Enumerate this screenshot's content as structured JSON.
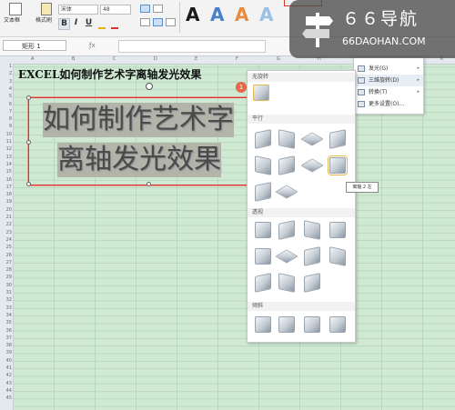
{
  "ribbon": {
    "textbox_label": "文本框",
    "format_painter_label": "格式刷",
    "font_name": "宋体",
    "font_size": "48",
    "bold": "B",
    "italic": "I",
    "underline": "U",
    "art_styles": [
      {
        "glyph": "A",
        "color": "#1a1a1a"
      },
      {
        "glyph": "A",
        "color": "#4a7fc9"
      },
      {
        "glyph": "A",
        "color": "#e88b3f"
      },
      {
        "glyph": "A",
        "color": "#9cc0e3"
      }
    ]
  },
  "formula_bar": {
    "name_box": "矩形 1"
  },
  "sheet": {
    "columns": [
      "A",
      "B",
      "C",
      "D",
      "E",
      "F",
      "G",
      "H",
      "I",
      "J",
      "K"
    ],
    "rows": [
      "1",
      "2",
      "3",
      "4",
      "5",
      "6",
      "7",
      "8",
      "9",
      "10",
      "11",
      "12",
      "13",
      "14",
      "15",
      "16",
      "17",
      "18",
      "19",
      "20",
      "21",
      "22",
      "23",
      "24",
      "25",
      "26",
      "27",
      "28",
      "29",
      "30",
      "31",
      "32",
      "33",
      "34",
      "35",
      "36",
      "37",
      "38",
      "39",
      "40",
      "41",
      "42",
      "43",
      "44",
      "45"
    ],
    "title_text": "EXCEL如何制作艺术字离轴发光效果",
    "art_line1": "如何制作艺术字",
    "art_line2": "离轴发光效果",
    "badge_number": "1"
  },
  "effects_menu": {
    "items": [
      {
        "label": "发光(G)",
        "has_arrow": true
      },
      {
        "label": "三维旋转(D)",
        "has_arrow": true
      },
      {
        "label": "转换(T)",
        "has_arrow": true
      },
      {
        "label": "更多设置(O)...",
        "has_arrow": false
      }
    ]
  },
  "rotation_gallery": {
    "sections": [
      {
        "title": "无旋转",
        "count": 1
      },
      {
        "title": "平行",
        "count": 10
      },
      {
        "title": "透视",
        "count": 11
      },
      {
        "title": "倾斜",
        "count": 4
      }
    ],
    "tooltip": "离轴 2 左"
  },
  "watermark": {
    "title": "６６导航",
    "url": "66DAOHAN.COM"
  }
}
